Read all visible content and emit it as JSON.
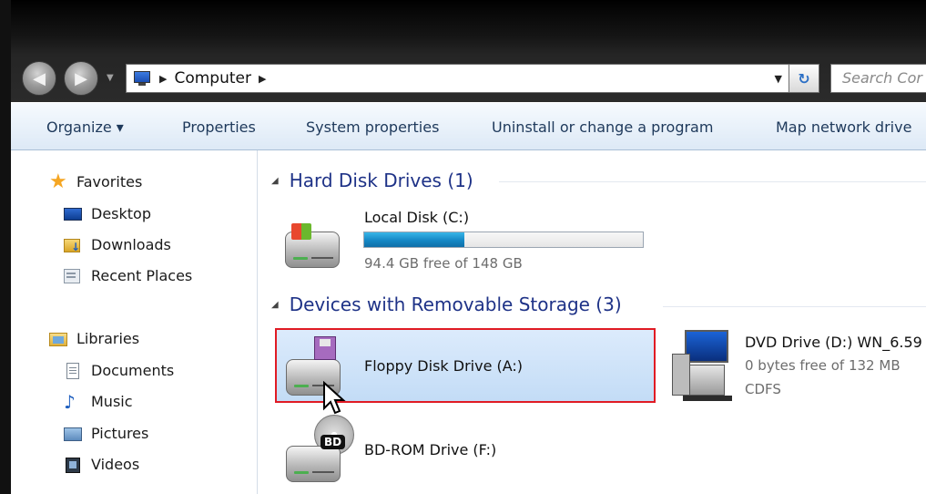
{
  "address_bar": {
    "crumb": "Computer",
    "search_placeholder": "Search Cor"
  },
  "toolbar": {
    "organize": "Organize ▾",
    "properties": "Properties",
    "system_properties": "System properties",
    "uninstall": "Uninstall or change a program",
    "map_drive": "Map network drive"
  },
  "nav": {
    "favorites_header": "Favorites",
    "favorites": [
      "Desktop",
      "Downloads",
      "Recent Places"
    ],
    "libraries_header": "Libraries",
    "libraries": [
      "Documents",
      "Music",
      "Pictures",
      "Videos"
    ]
  },
  "groups": {
    "hard_disks": "Hard Disk Drives (1)",
    "removable": "Devices with Removable Storage (3)"
  },
  "drives": {
    "local": {
      "name": "Local Disk (C:)",
      "free": "94.4 GB free of 148 GB",
      "used_fraction": 0.36
    },
    "floppy": {
      "name": "Floppy Disk Drive (A:)"
    },
    "dvd": {
      "name": "DVD Drive (D:) WN_6.59",
      "free": "0 bytes free of 132 MB",
      "fs": "CDFS"
    },
    "bd": {
      "name": "BD-ROM Drive (F:)",
      "badge": "BD"
    }
  },
  "colors": {
    "group_header": "#1e3287",
    "selection_outline": "#e01b24",
    "progress_fill": "#1587c5"
  }
}
